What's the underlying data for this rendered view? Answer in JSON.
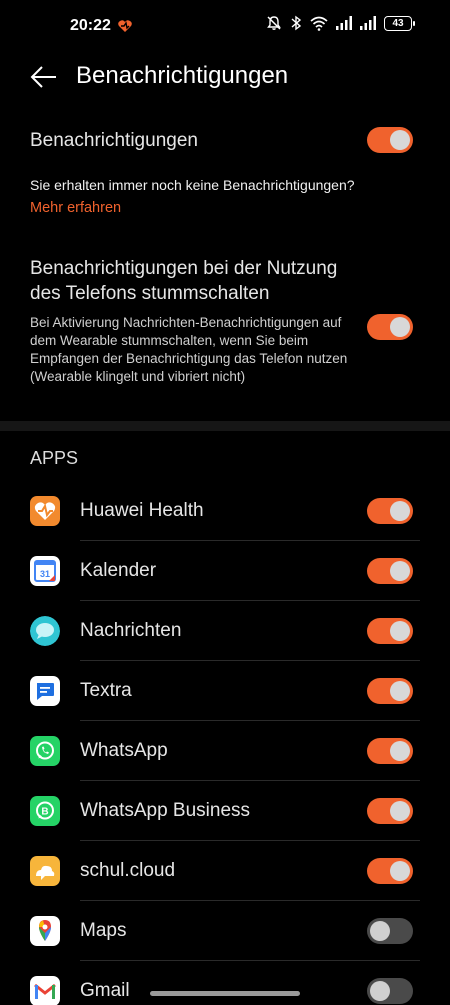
{
  "status": {
    "time": "20:22",
    "battery": "43"
  },
  "header": {
    "title": "Benachrichtigungen"
  },
  "main_toggle": {
    "label": "Benachrichtigungen",
    "on": true
  },
  "hint": {
    "text": "Sie erhalten immer noch keine Benachrichtigungen?",
    "link": "Mehr erfahren"
  },
  "mute": {
    "title": "Benachrichtigungen bei der Nutzung des Telefons stummschalten",
    "description": "Bei Aktivierung Nachrichten-Benachrichtigungen auf dem Wearable stummschalten, wenn Sie beim Empfangen der Benachrichtigung das Telefon nutzen (Wearable klingelt und vibriert nicht)",
    "on": true
  },
  "apps_section": {
    "header": "APPS",
    "items": [
      {
        "name": "Huawei Health",
        "icon": "huawei-health-icon",
        "on": true
      },
      {
        "name": "Kalender",
        "icon": "calendar-icon",
        "on": true
      },
      {
        "name": "Nachrichten",
        "icon": "messages-icon",
        "on": true
      },
      {
        "name": "Textra",
        "icon": "textra-icon",
        "on": true
      },
      {
        "name": "WhatsApp",
        "icon": "whatsapp-icon",
        "on": true
      },
      {
        "name": "WhatsApp Business",
        "icon": "whatsapp-business-icon",
        "on": true
      },
      {
        "name": "schul.cloud",
        "icon": "schul-cloud-icon",
        "on": true
      },
      {
        "name": "Maps",
        "icon": "maps-icon",
        "on": false
      },
      {
        "name": "Gmail",
        "icon": "gmail-icon",
        "on": false
      }
    ]
  },
  "colors": {
    "accent": "#f0622d",
    "background": "#000000",
    "toggle_off": "#4a4a4a"
  }
}
